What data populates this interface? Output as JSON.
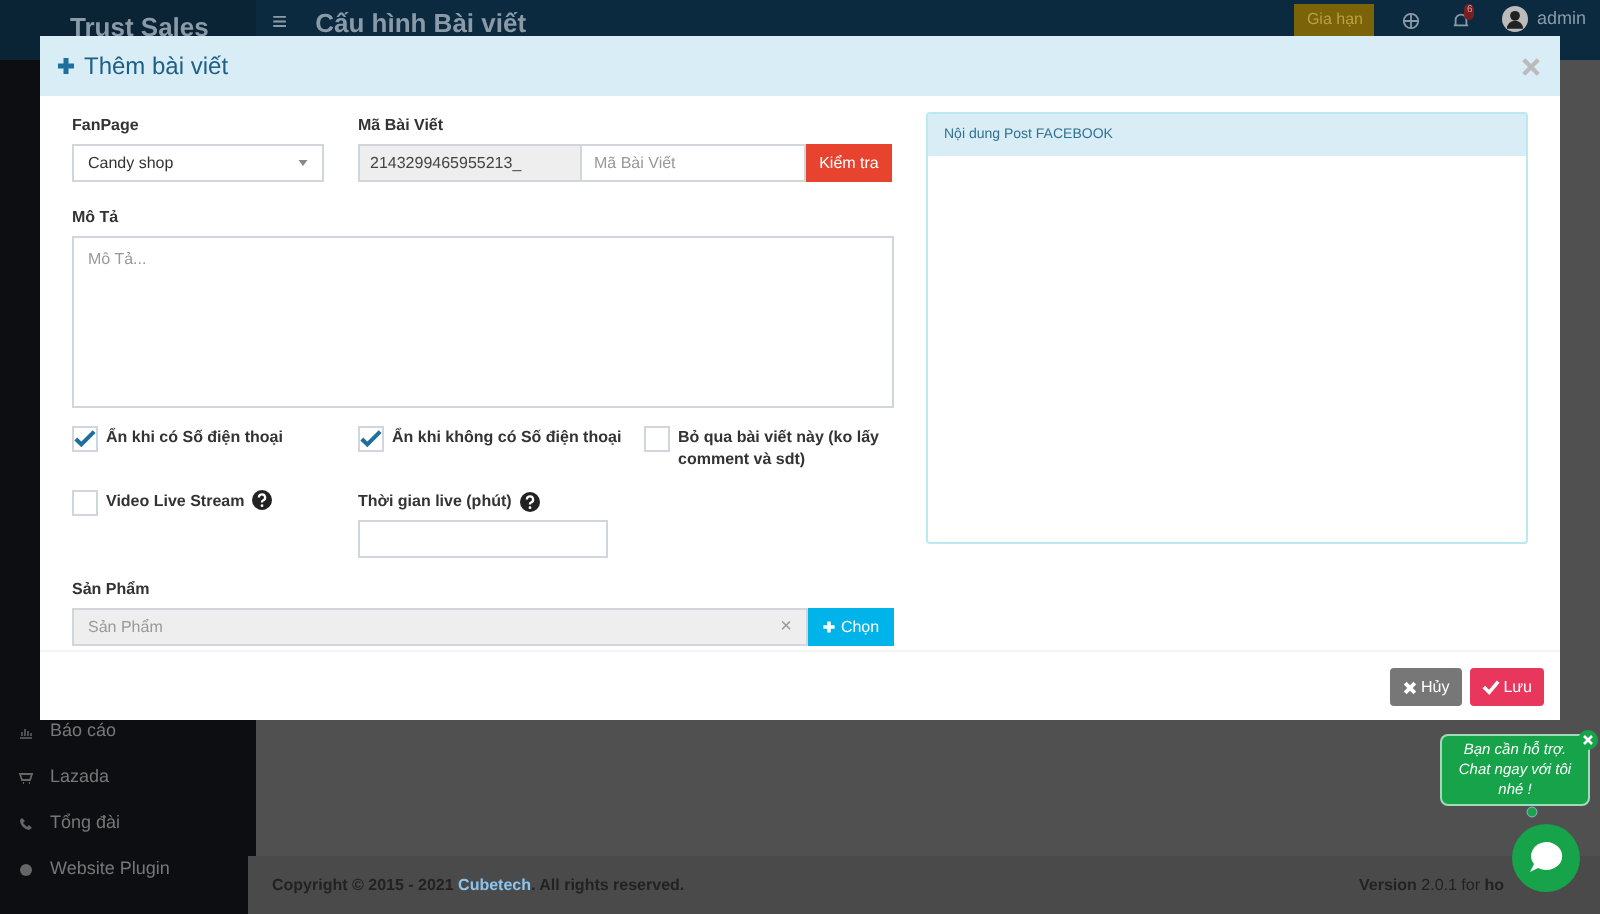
{
  "header": {
    "brand": "Trust Sales",
    "menu_icon": "≡",
    "page_title": "Cấu hình Bài viết",
    "renew_button": "Gia hạn",
    "notification_count": "6",
    "user": "admin"
  },
  "sidebar": {
    "items": [
      {
        "label": "Báo cáo"
      },
      {
        "label": "Lazada"
      },
      {
        "label": "Tổng đài"
      },
      {
        "label": "Website Plugin"
      }
    ]
  },
  "footer": {
    "copyright": {
      "before": "Copyright © 2015 - 2021",
      "link": "Cubetech",
      "after": ". All rights reserved."
    },
    "version": "**Version** 2.0.1 for **ho**"
  },
  "modal": {
    "title": "Thêm bài viết",
    "fanpage": {
      "label": "FanPage",
      "value": "Candy shop"
    },
    "post_id": {
      "label": "Mã Bài Viết",
      "prefix": "2143299465955213_",
      "placeholder": "Mã Bài Viết",
      "button": "Kiểm tra"
    },
    "description": {
      "label": "Mô Tả",
      "placeholder": "Mô Tả..."
    },
    "options": [
      {
        "label": "Ẩn khi có Số điện thoại",
        "checked": true
      },
      {
        "label": "Ẩn khi không có Số điện thoại",
        "checked": true
      },
      {
        "label": "Bỏ qua bài viết này (ko lấy comment và sdt)",
        "checked": false
      }
    ],
    "live_stream": {
      "label": "Video Live Stream",
      "checked": false
    },
    "live_time": {
      "label": "Thời gian live (phút)"
    },
    "product": {
      "label": "Sản Phẩm",
      "placeholder": "Sản Phẩm",
      "clear": "×",
      "button": "Chọn"
    },
    "preview": {
      "title": "Nội dung Post FACEBOOK"
    },
    "buttons": [
      {
        "label": "Hủy",
        "kind": "cancel"
      },
      {
        "label": "Lưu",
        "kind": "save"
      }
    ]
  },
  "chat": {
    "message": "Bạn cần hỗ trợ. Chat ngay với tôi nhé !"
  }
}
